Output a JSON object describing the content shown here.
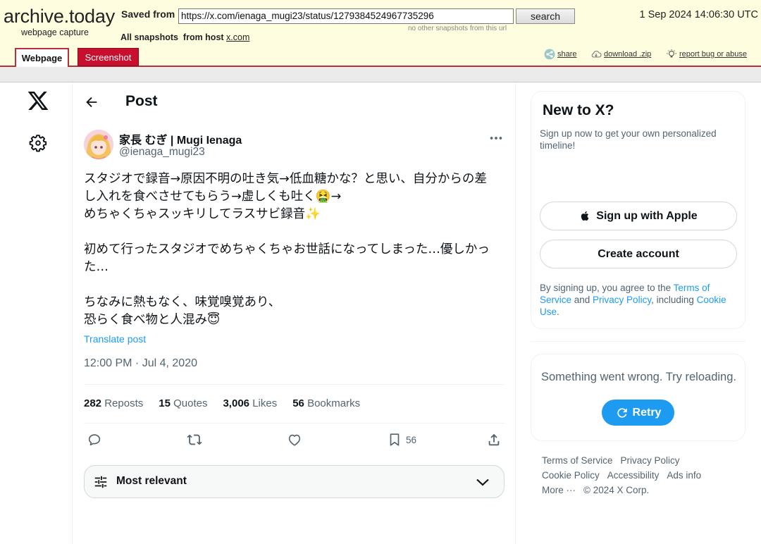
{
  "archive": {
    "brand": "archive.today",
    "brand_sub": "webpage capture",
    "saved_from_label": "Saved from",
    "url": "https://x.com/ienaga_mugi23/status/1279384524967735296",
    "search_label": "search",
    "no_other_note": "no other snapshots from this url",
    "timestamp": "1 Sep 2024 14:06:30 UTC",
    "all_snapshots_label": "All snapshots",
    "from_host_label": "from host",
    "host": "x.com",
    "tabs": [
      "Webpage",
      "Screenshot"
    ],
    "tools": [
      "share",
      "download .zip",
      "report bug or abuse"
    ],
    "colors": {
      "header_bg": "#fffde0",
      "accent": "#c8102e"
    }
  },
  "sidebar": {
    "logo_icon": "x-logo-icon",
    "settings_icon": "gear-icon"
  },
  "post": {
    "header_title": "Post",
    "author_name": "家長 むぎ | Mugi Ienaga",
    "author_handle": "@ienaga_mugi23",
    "text_lines": [
      "スタジオで録音→原因不明の吐き気→低血糖かな？と思い、自分からの差",
      "し入れを食べさせてもらう→虚しくも吐く🤮→",
      "めちゃくちゃスッキリしてラスサビ録音✨",
      "",
      "初めて行ったスタジオでめちゃくちゃお世話になってしまった…優しかっ",
      "た…",
      "",
      "ちなみに熱もなく、味覚嗅覚あり、",
      "恐らく食べ物と人混み😇"
    ],
    "translate_label": "Translate post",
    "time": "12:00 PM · Jul 4, 2020",
    "stats": [
      {
        "count": "282",
        "label": "Reposts"
      },
      {
        "count": "15",
        "label": "Quotes"
      },
      {
        "count": "3,006",
        "label": "Likes"
      },
      {
        "count": "56",
        "label": "Bookmarks"
      }
    ],
    "bookmark_count": "56",
    "sort_label": "Most relevant"
  },
  "signup": {
    "title": "New to X?",
    "subtitle": "Sign up now to get your own personalized timeline!",
    "apple_label": "Sign up with Apple",
    "create_label": "Create account",
    "terms_prefix": "By signing up, you agree to the ",
    "terms_link": "Terms of Service",
    "terms_and": " and ",
    "privacy_link": "Privacy Policy",
    "terms_including": ", including ",
    "cookie_link": "Cookie Use",
    "terms_end": "."
  },
  "error": {
    "message": "Something went wrong. Try reloading.",
    "retry_label": "Retry"
  },
  "footer": {
    "links": [
      "Terms of Service",
      "Privacy Policy",
      "Cookie Policy",
      "Accessibility",
      "Ads info",
      "More ···"
    ],
    "copyright": "© 2024 X Corp."
  },
  "colors": {
    "x_blue": "#1d9bf0",
    "text_secondary": "#536471",
    "text_primary": "#0f1419"
  }
}
